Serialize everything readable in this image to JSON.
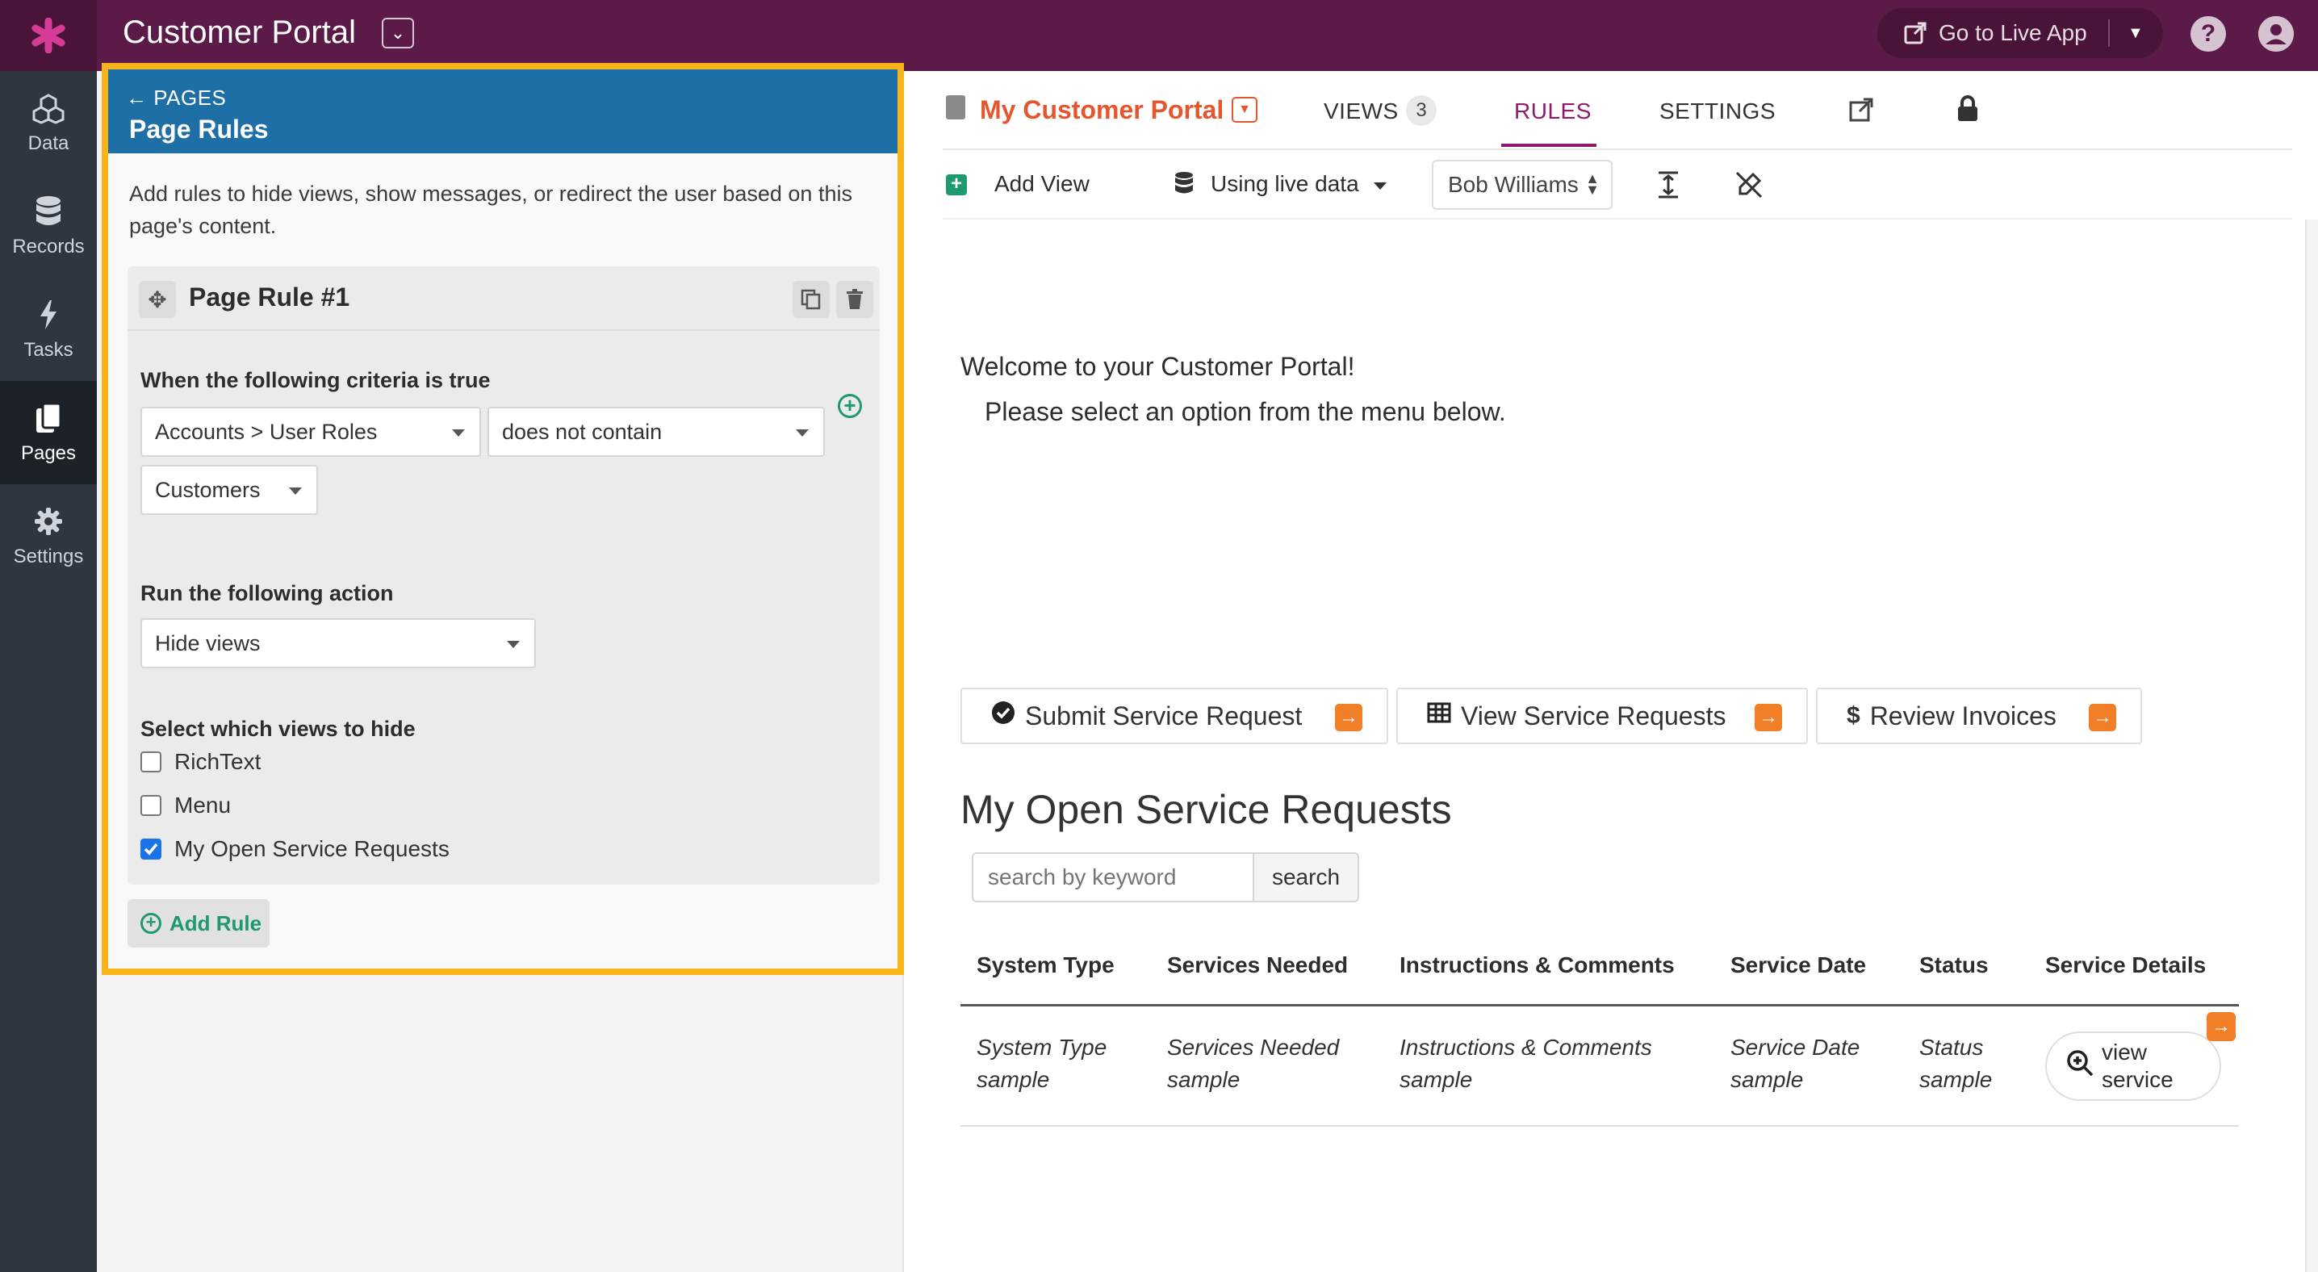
{
  "app": {
    "title": "Customer Portal",
    "title_caret": "⌄",
    "go_live_label": "Go to Live App",
    "help_icon": "?",
    "account_icon": "person"
  },
  "leftnav": [
    {
      "label": "Data",
      "icon": "cubes-icon"
    },
    {
      "label": "Records",
      "icon": "database-icon"
    },
    {
      "label": "Tasks",
      "icon": "bolt-icon"
    },
    {
      "label": "Pages",
      "icon": "pages-icon"
    },
    {
      "label": "Settings",
      "icon": "gear-icon"
    }
  ],
  "panel": {
    "back_label": "PAGES",
    "title": "Page Rules",
    "description": "Add rules to hide views, show messages, or redirect the user based on this page's content.",
    "rule": {
      "title": "Page Rule #1",
      "criteria_label": "When the following criteria is true",
      "field_select": "Accounts > User Roles",
      "operator_select": "does not contain",
      "value_select": "Customers",
      "action_label": "Run the following action",
      "action_select": "Hide views",
      "views_label": "Select which views to hide",
      "views": [
        {
          "label": "RichText",
          "checked": false
        },
        {
          "label": "Menu",
          "checked": false
        },
        {
          "label": "My Open Service Requests",
          "checked": true
        }
      ]
    },
    "add_rule_label": "Add Rule"
  },
  "page": {
    "name": "My Customer Portal",
    "tabs": [
      {
        "label": "VIEWS",
        "count": "3"
      },
      {
        "label": "RULES"
      },
      {
        "label": "SETTINGS"
      }
    ],
    "toolbar": {
      "add_view": "Add View",
      "live_data": "Using live data",
      "user": "Bob Williams"
    }
  },
  "content": {
    "welcome_line1": "Welcome to your Customer Portal!",
    "welcome_line2": "Please select an option from the menu below.",
    "menu": [
      {
        "label": "Submit Service Request",
        "icon": "check-circle-icon"
      },
      {
        "label": "View Service Requests",
        "icon": "table-icon"
      },
      {
        "label": "Review Invoices",
        "icon": "dollar-icon"
      }
    ],
    "table_title": "My Open Service Requests",
    "search_placeholder": "search by keyword",
    "search_button": "search",
    "columns": [
      "System Type",
      "Services Needed",
      "Instructions & Comments",
      "Service Date",
      "Status",
      "Service Details"
    ],
    "row": [
      "System Type sample",
      "Services Needed sample",
      "Instructions & Comments sample",
      "Service Date sample",
      "Status sample"
    ],
    "view_service_label": "view service"
  },
  "colors": {
    "topbar": "#5b1a48",
    "accent_orange": "#e4572e",
    "highlight": "#f9b31b",
    "panel_header": "#1f6fa7",
    "green": "#1e9a6d"
  }
}
